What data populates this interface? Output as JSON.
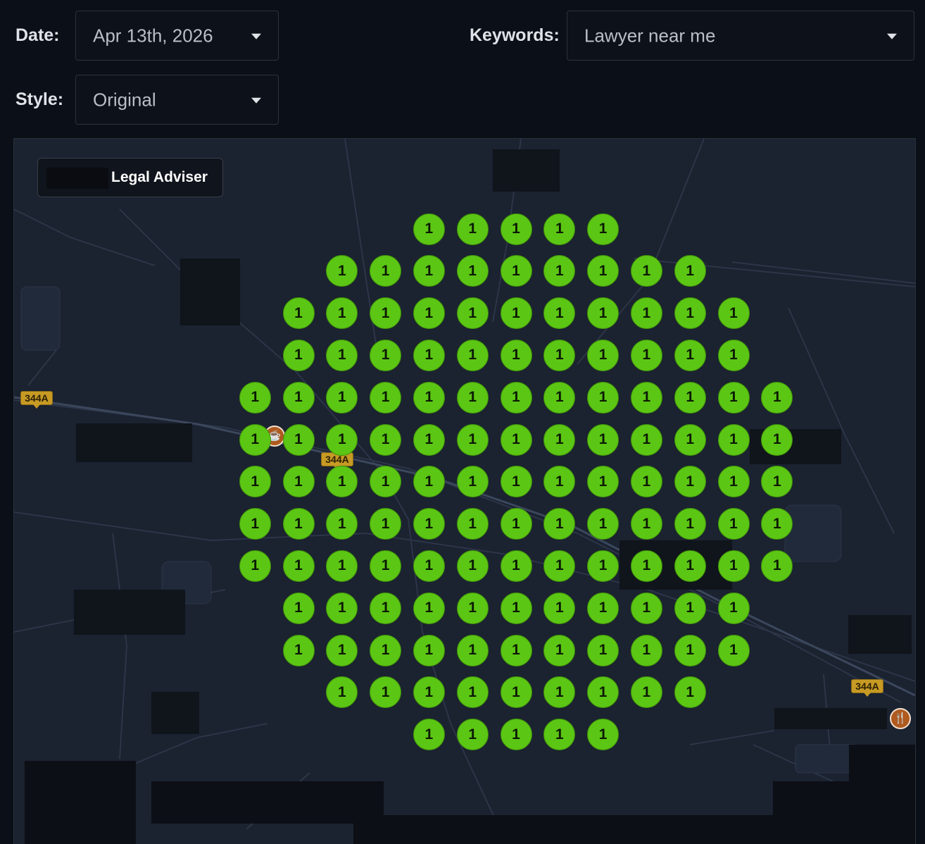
{
  "controls": {
    "date_label": "Date:",
    "date_value": "Apr 13th, 2026",
    "keywords_label": "Keywords:",
    "keywords_value": "Lawyer near me",
    "style_label": "Style:",
    "style_value": "Original"
  },
  "map": {
    "business_label": "Legal Adviser",
    "road_badges": [
      "344A",
      "344A",
      "344A"
    ],
    "poi_icons": [
      "cafe-icon",
      "restaurant-icon"
    ],
    "pin_color": "#5cc614",
    "grid_rows": [
      [
        "1",
        "1",
        "1",
        "1",
        "1"
      ],
      [
        "1",
        "1",
        "1",
        "1",
        "1",
        "1",
        "1",
        "1",
        "1"
      ],
      [
        "1",
        "1",
        "1",
        "1",
        "1",
        "1",
        "1",
        "1",
        "1",
        "1",
        "1"
      ],
      [
        "1",
        "1",
        "1",
        "1",
        "1",
        "1",
        "1",
        "1",
        "1",
        "1",
        "1"
      ],
      [
        "1",
        "1",
        "1",
        "1",
        "1",
        "1",
        "1",
        "1",
        "1",
        "1",
        "1",
        "1",
        "1"
      ],
      [
        "1",
        "1",
        "1",
        "1",
        "1",
        "1",
        "1",
        "1",
        "1",
        "1",
        "1",
        "1",
        "1"
      ],
      [
        "1",
        "1",
        "1",
        "1",
        "1",
        "1",
        "1",
        "1",
        "1",
        "1",
        "1",
        "1",
        "1"
      ],
      [
        "1",
        "1",
        "1",
        "1",
        "1",
        "1",
        "1",
        "1",
        "1",
        "1",
        "1",
        "1",
        "1"
      ],
      [
        "1",
        "1",
        "1",
        "1",
        "1",
        "1",
        "1",
        "1",
        "1",
        "1",
        "1",
        "1",
        "1"
      ],
      [
        "1",
        "1",
        "1",
        "1",
        "1",
        "1",
        "1",
        "1",
        "1",
        "1",
        "1"
      ],
      [
        "1",
        "1",
        "1",
        "1",
        "1",
        "1",
        "1",
        "1",
        "1",
        "1",
        "1"
      ],
      [
        "1",
        "1",
        "1",
        "1",
        "1",
        "1",
        "1",
        "1",
        "1"
      ],
      [
        "1",
        "1",
        "1",
        "1",
        "1"
      ]
    ]
  }
}
